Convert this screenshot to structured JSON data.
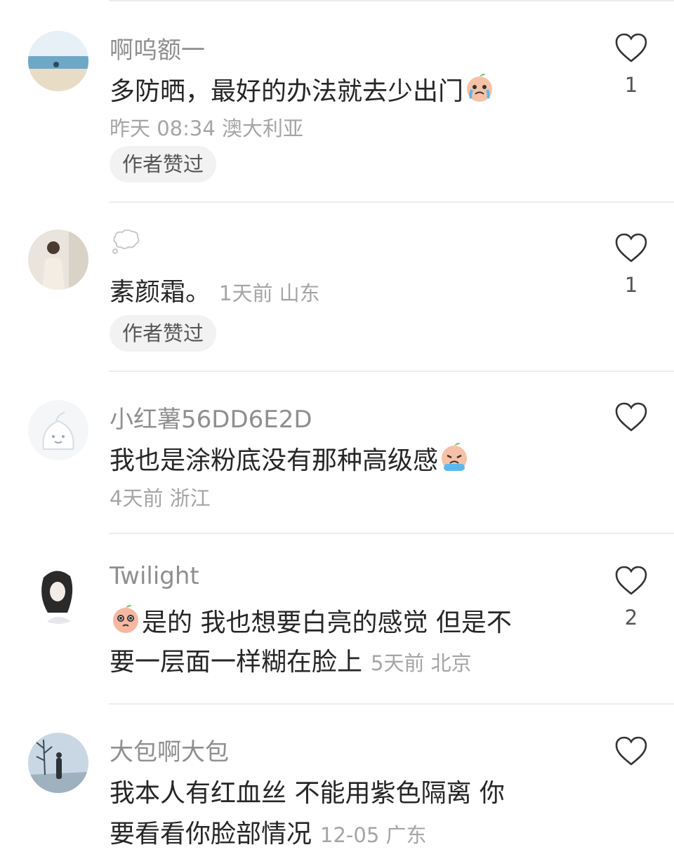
{
  "comments": [
    {
      "name": "啊呜额一",
      "text": "多防晒，最好的办法就去少出门",
      "meta": "昨天 08:34 澳大利亚",
      "badge": "作者赞过",
      "likes": "1",
      "emoji": "crying-face-emoji"
    },
    {
      "name": "",
      "text": "素颜霜。",
      "meta": "1天前  山东",
      "badge": "作者赞过",
      "likes": "1",
      "name_icon": "thought-bubble-icon"
    },
    {
      "name": "小红薯56DD6E2D",
      "text": "我也是涂粉底没有那种高级感",
      "meta": "4天前  浙江",
      "likes": "",
      "emoji": "crying-face-emoji"
    },
    {
      "name": "Twilight",
      "text_line1": "是的 我也想要白亮的感觉 但是不",
      "text_line2": "要一层面一样糊在脸上",
      "meta": "5天前  北京",
      "likes": "2",
      "emoji": "pleading-face-emoji"
    },
    {
      "name": "大包啊大包",
      "text_line1": "我本人有红血丝 不能用紫色隔离 你",
      "text_line2": "要看看你脸部情况",
      "meta": "12-05 广东",
      "likes": ""
    }
  ],
  "colors": {
    "name": "#8f8f8f",
    "text": "#262626",
    "meta": "#a5a5a5",
    "badge_bg": "#f2f2f2",
    "heart_outline": "#333333"
  }
}
